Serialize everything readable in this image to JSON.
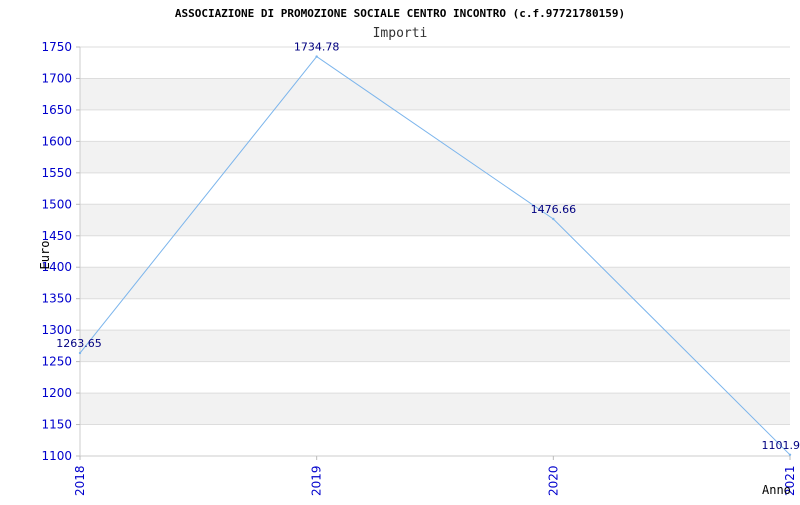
{
  "chart_data": {
    "type": "line",
    "title": "ASSOCIAZIONE DI PROMOZIONE SOCIALE CENTRO INCONTRO (c.f.97721780159)",
    "subtitle": "Importi",
    "xlabel": "Anno",
    "ylabel": "Euro",
    "categories": [
      "2018",
      "2019",
      "2020",
      "2021"
    ],
    "values": [
      1263.65,
      1734.78,
      1476.66,
      1101.9
    ],
    "data_labels": [
      "1263.65",
      "1734.78",
      "1476.66",
      "1101.9"
    ],
    "ylim": [
      1100,
      1750
    ],
    "yticks": [
      1100,
      1150,
      1200,
      1250,
      1300,
      1350,
      1400,
      1450,
      1500,
      1550,
      1600,
      1650,
      1700,
      1750
    ],
    "grid": "horizontal alternating bands",
    "colors": {
      "line": "#7cb5ec",
      "band": "#f2f2f2",
      "tick_text": "#0000cc",
      "data_label": "#000080",
      "title": "#000000"
    }
  }
}
